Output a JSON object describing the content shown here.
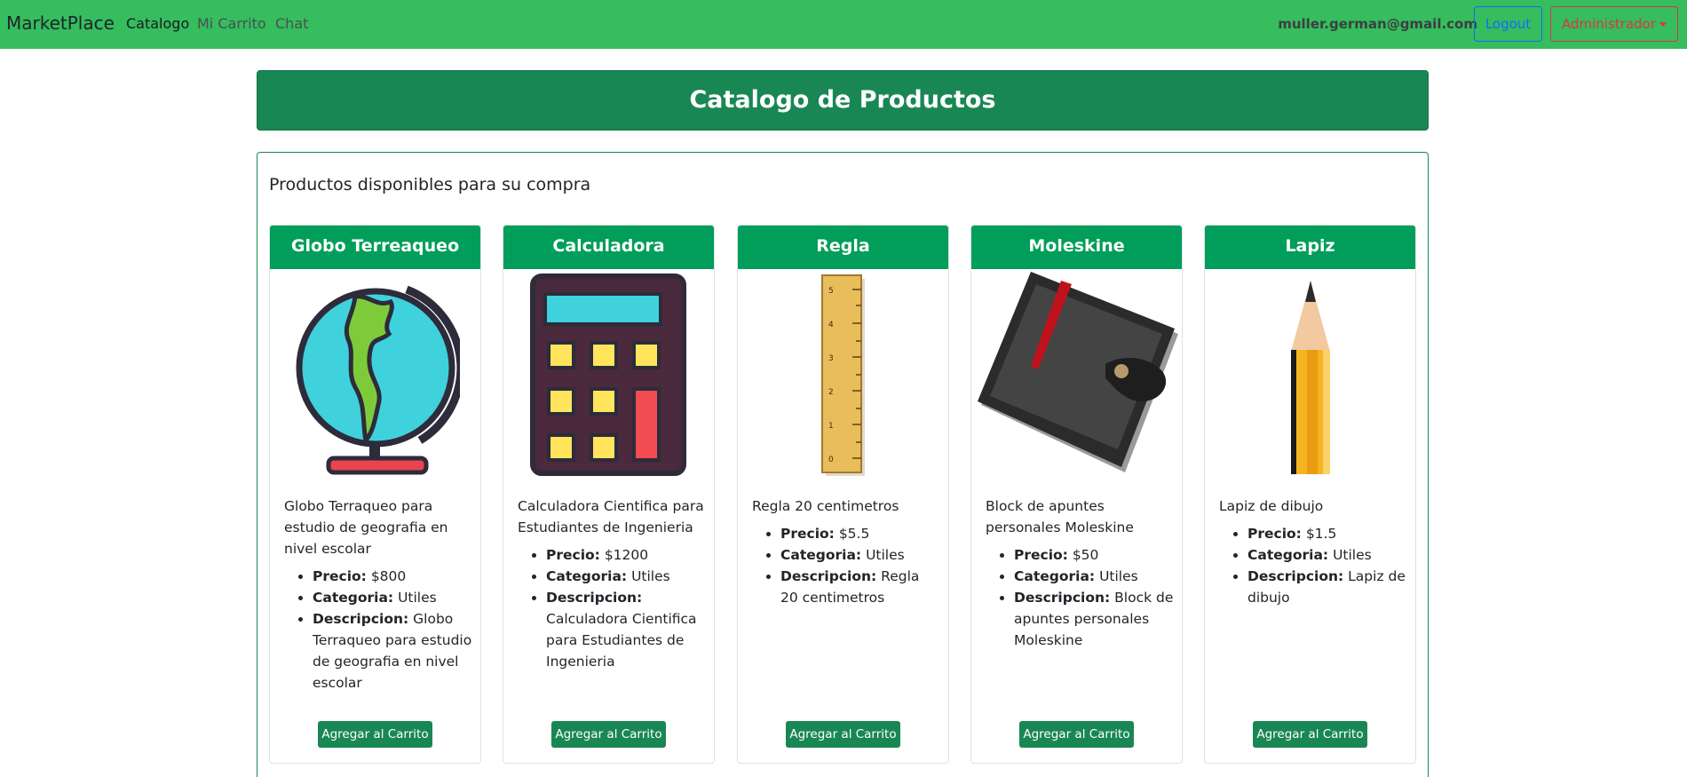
{
  "navbar": {
    "brand": "MarketPlace",
    "links": [
      "Catalogo",
      "Mi Carrito",
      "Chat"
    ],
    "user_email": "muller.german@gmail.com",
    "logout_label": "Logout",
    "admin_label": "Administrador"
  },
  "banner": {
    "title": "Catalogo de Productos"
  },
  "main": {
    "subtitle": "Productos disponibles para su compra"
  },
  "labels": {
    "price": "Precio:",
    "category": "Categoria:",
    "description": "Descripcion:"
  },
  "products": [
    {
      "name": "Globo Terreaqueo",
      "icon": "globe-icon",
      "summary": "Globo Terraqueo para estudio de geografia en nivel escolar",
      "price": "$800",
      "category": "Utiles",
      "description": "Globo Terraqueo para estudio de geografia en nivel escolar",
      "button": "Agregar al Carrito"
    },
    {
      "name": "Calculadora",
      "icon": "calculator-icon",
      "summary": "Calculadora Cientifica para Estudiantes de Ingenieria",
      "price": "$1200",
      "category": "Utiles",
      "description": "Calculadora Cientifica para Estudiantes de Ingenieria",
      "button": "Agregar al Carrito"
    },
    {
      "name": "Regla",
      "icon": "ruler-icon",
      "summary": "Regla 20 centimetros",
      "price": "$5.5",
      "category": "Utiles",
      "description": "Regla 20 centimetros",
      "button": "Agregar al Carrito"
    },
    {
      "name": "Moleskine",
      "icon": "notebook-icon",
      "summary": "Block de apuntes personales Moleskine",
      "price": "$50",
      "category": "Utiles",
      "description": "Block de apuntes personales Moleskine",
      "button": "Agregar al Carrito"
    },
    {
      "name": "Lapiz",
      "icon": "pencil-icon",
      "summary": "Lapiz de dibujo",
      "price": "$1.5",
      "category": "Utiles",
      "description": "Lapiz de dibujo",
      "button": "Agregar al Carrito"
    }
  ],
  "colors": {
    "navbar": "#35bd5e",
    "banner": "#198754",
    "card_header": "#009e5a",
    "logout": "#0d6efd",
    "admin": "#dc3545"
  }
}
